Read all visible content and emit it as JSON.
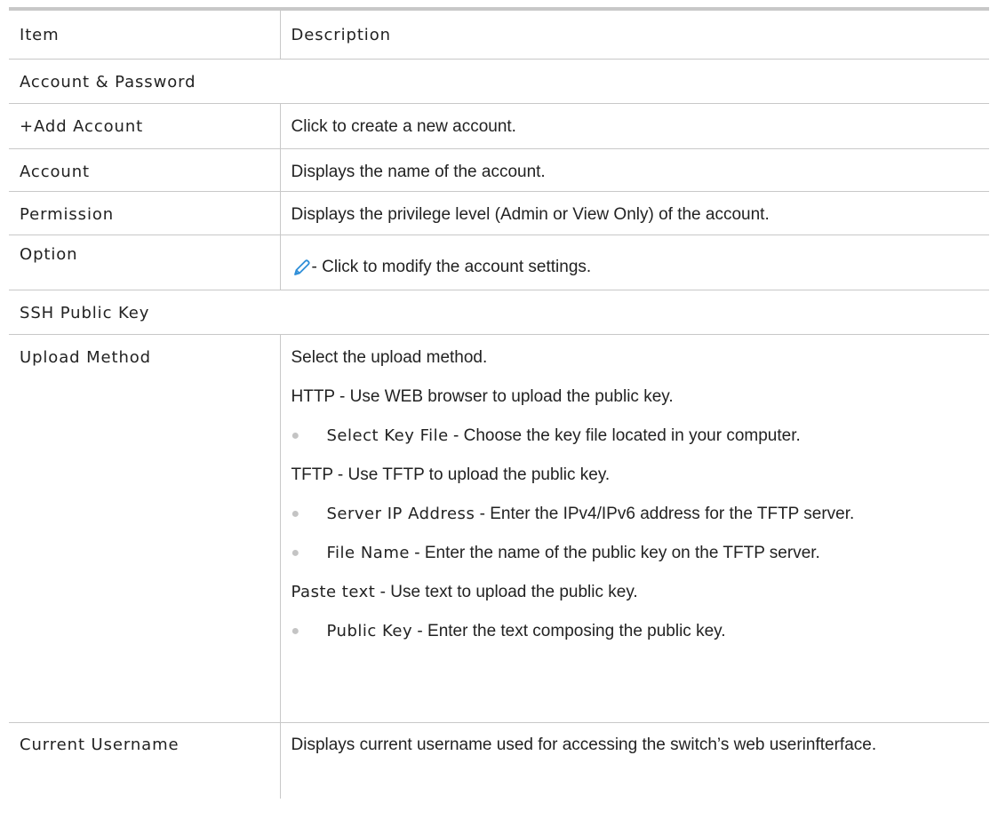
{
  "table": {
    "header": {
      "item": "Item",
      "description": "Description"
    },
    "section_account": "Account & Password",
    "rows_account": [
      {
        "item": "+Add Account",
        "description": "Click to create a new account."
      },
      {
        "item": "Account",
        "description": "Displays the name of the account."
      },
      {
        "item": "Permission",
        "description": "Displays the privilege level (Admin or View Only) of the account."
      },
      {
        "item": "Option",
        "description": "- Click to modify the account settings.",
        "icon": "pencil-edit-icon"
      }
    ],
    "section_ssh": "SSH Public Key",
    "upload": {
      "item": "Upload Method",
      "intro": "Select the upload method.",
      "http": "HTTP - Use WEB browser to upload the public key.",
      "http_bullet_kw": "Select Key File",
      "http_bullet_text": " - Choose the key file located in your computer.",
      "tftp": "TFTP - Use TFTP to upload the public key.",
      "tftp_bullet1_kw": "Server IP Address",
      "tftp_bullet1_text": " - Enter the IPv4/IPv6 address for the TFTP server.",
      "tftp_bullet2_kw": "File Name",
      "tftp_bullet2_text": " - Enter the name of the public key on the TFTP server.",
      "paste_kw": "Paste text",
      "paste_text": " - Use text to upload the public key.",
      "paste_bullet_kw": "Public Key",
      "paste_bullet_text": " - Enter the text composing the public key."
    },
    "current_user": {
      "item": "Current Username",
      "description": "Displays current username used for accessing the switch’s web userinfterface."
    }
  },
  "colors": {
    "rule": "#c8c8c8",
    "text": "#222222",
    "bullet": "#c4c4c4",
    "pencil": "#2f8fd8"
  }
}
